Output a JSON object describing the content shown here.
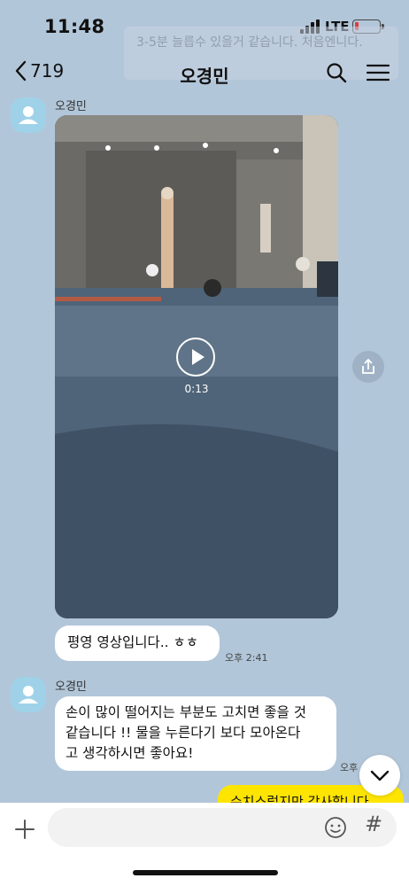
{
  "status_bar": {
    "time": "11:48",
    "network": "LTE",
    "battery_level": 0.15
  },
  "notice": {
    "text": "3-5분 늘릅수 있을거 같습니다. 처음엔니다."
  },
  "header": {
    "back_count": "719",
    "title": "오경민"
  },
  "messages": [
    {
      "sender": "오경민",
      "video_duration": "0:13"
    },
    {
      "text": "평영 영상입니다.. ㅎㅎ",
      "time": "오후 2:41"
    },
    {
      "sender": "오경민",
      "text_lines": [
        "손이 많이 떨어지는 부분도 고치면 좋을 것",
        "같습니다 !! 물을 누른다기 보다 모아온다",
        "고 생각하시면 좋아요!"
      ],
      "time": "오후"
    }
  ],
  "my_message": {
    "text": "수치스럽지만 감사합니다"
  },
  "input": {
    "placeholder": "",
    "hash": "#"
  },
  "colors": {
    "background": "#b2c6d9",
    "my_bubble": "#fee500",
    "avatar": "#9fd2e8"
  }
}
